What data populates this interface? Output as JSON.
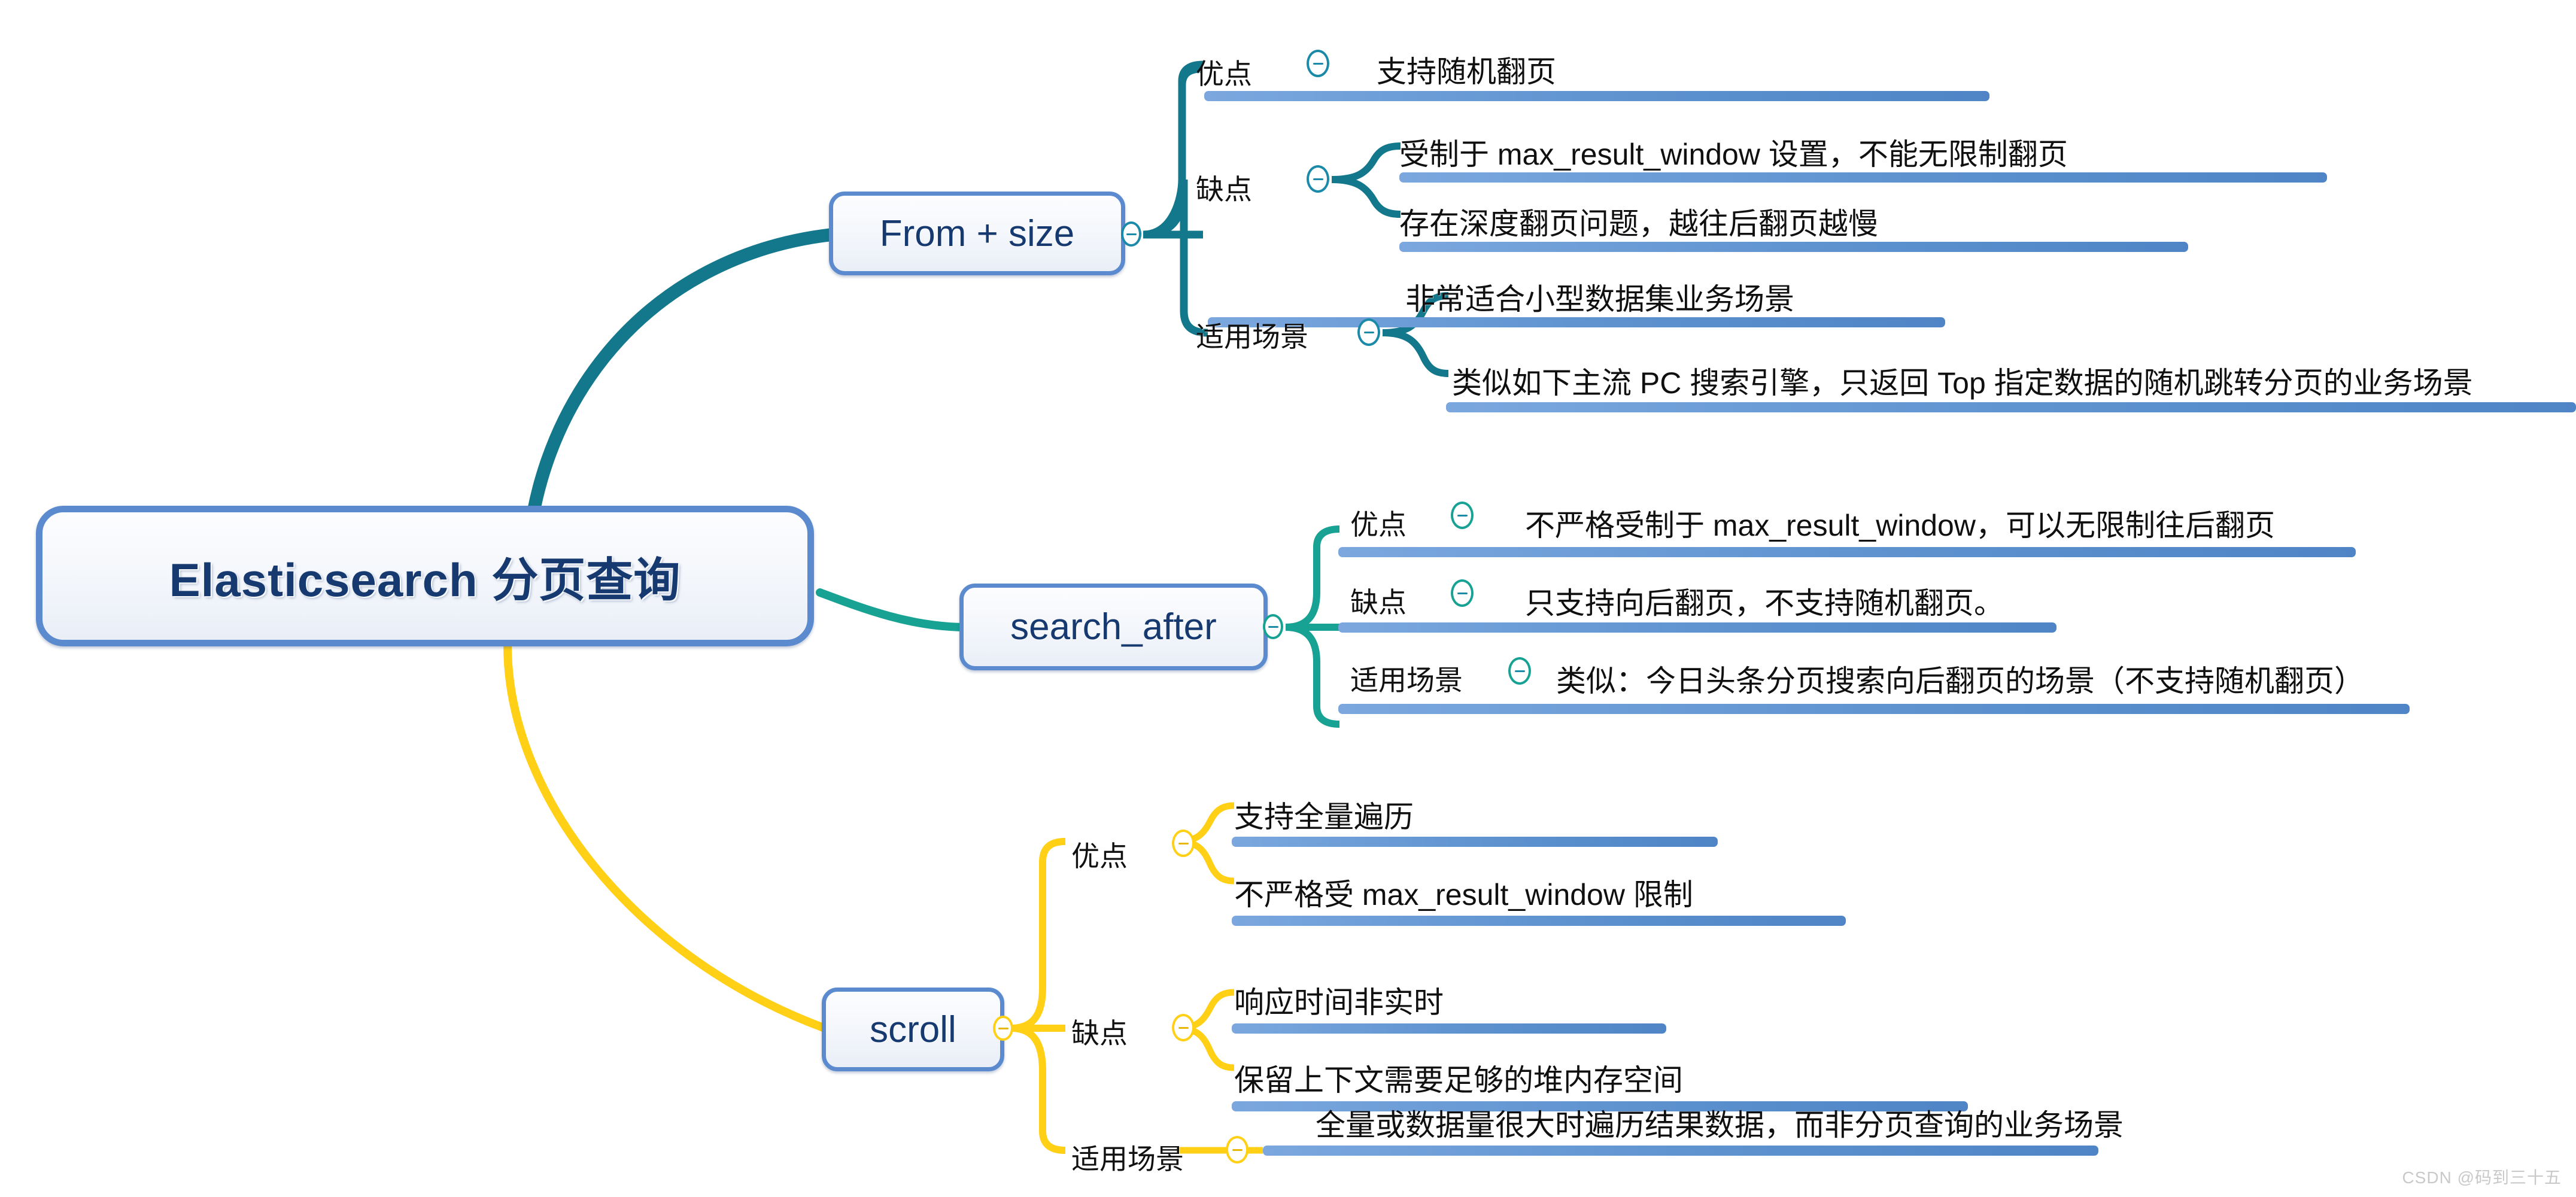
{
  "title": "Elasticsearch 分页查询 思维导图",
  "root": {
    "label": "Elasticsearch 分页查询",
    "color": "#5b8bce"
  },
  "branches": [
    {
      "key": "from_size",
      "label": "From + size",
      "color": "#14788c",
      "categories": [
        {
          "key": "pros",
          "label": "优点",
          "items": [
            {
              "text": "支持随机翻页"
            }
          ]
        },
        {
          "key": "cons",
          "label": "缺点",
          "items": [
            {
              "text": "受制于 max_result_window 设置，不能无限制翻页"
            },
            {
              "text": "存在深度翻页问题，越往后翻页越慢"
            }
          ]
        },
        {
          "key": "usecase",
          "label": "适用场景",
          "items": [
            {
              "text": "非常适合小型数据集业务场景"
            },
            {
              "text": "类似如下主流 PC 搜索引擎，只返回 Top 指定数据的随机跳转分页的业务场景"
            }
          ]
        }
      ]
    },
    {
      "key": "search_after",
      "label": "search_after",
      "color": "#17a293",
      "categories": [
        {
          "key": "pros",
          "label": "优点",
          "items": [
            {
              "text": "不严格受制于 max_result_window，可以无限制往后翻页"
            }
          ]
        },
        {
          "key": "cons",
          "label": "缺点",
          "items": [
            {
              "text": "只支持向后翻页，不支持随机翻页。"
            }
          ]
        },
        {
          "key": "usecase",
          "label": "适用场景",
          "items": [
            {
              "text": "类似：今日头条分页搜索向后翻页的场景（不支持随机翻页）"
            }
          ]
        }
      ]
    },
    {
      "key": "scroll",
      "label": "scroll",
      "color": "#ffd015",
      "categories": [
        {
          "key": "pros",
          "label": "优点",
          "items": [
            {
              "text": "支持全量遍历"
            },
            {
              "text": "不严格受 max_result_window 限制"
            }
          ]
        },
        {
          "key": "cons",
          "label": "缺点",
          "items": [
            {
              "text": "响应时间非实时"
            },
            {
              "text": "保留上下文需要足够的堆内存空间"
            }
          ]
        },
        {
          "key": "usecase",
          "label": "适用场景",
          "items": [
            {
              "text": "全量或数据量很大时遍历结果数据，而非分页查询的业务场景"
            }
          ]
        }
      ]
    }
  ],
  "icons": {
    "collapse": "minus-circle-icon"
  },
  "watermark": "CSDN @码到三十五"
}
